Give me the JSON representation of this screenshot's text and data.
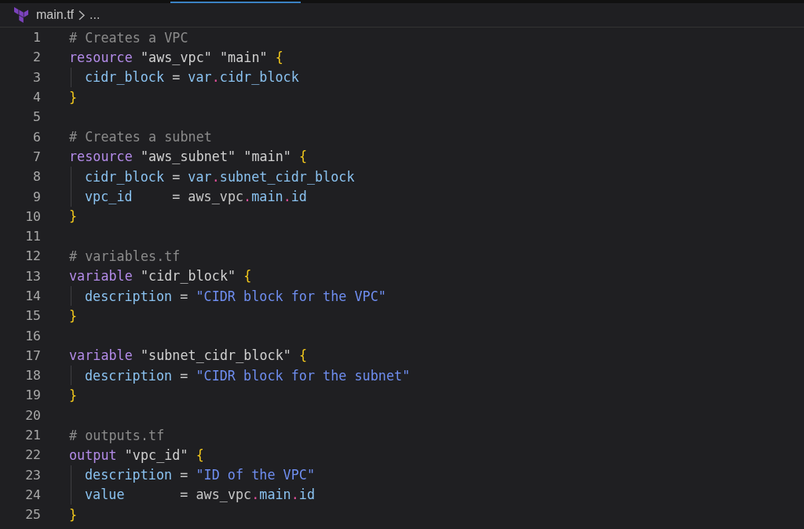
{
  "breadcrumb": {
    "file": "main.tf",
    "more": "..."
  },
  "lines": [
    {
      "number": "1",
      "tokens": [
        {
          "kind": "comment",
          "text": "# Creates a VPC"
        }
      ]
    },
    {
      "number": "2",
      "tokens": [
        {
          "kind": "keyword",
          "text": "resource"
        },
        {
          "kind": "label",
          "text": " \"aws_vpc\""
        },
        {
          "kind": "label",
          "text": " \"main\""
        },
        {
          "kind": "brace",
          "text": " {"
        }
      ],
      "children": [
        {
          "number": "3",
          "tokens": [
            {
              "kind": "attr",
              "text": "cidr_block"
            },
            {
              "kind": "op",
              "text": " = "
            },
            {
              "kind": "attr",
              "text": "var"
            },
            {
              "kind": "dot",
              "text": "."
            },
            {
              "kind": "attr",
              "text": "cidr_block"
            }
          ]
        }
      ]
    },
    {
      "number": "4",
      "tokens": [
        {
          "kind": "brace",
          "text": "}"
        }
      ]
    },
    {
      "number": "5"
    },
    {
      "number": "6",
      "tokens": [
        {
          "kind": "comment",
          "text": "# Creates a subnet"
        }
      ]
    },
    {
      "number": "7",
      "tokens": [
        {
          "kind": "keyword",
          "text": "resource"
        },
        {
          "kind": "label",
          "text": " \"aws_subnet\""
        },
        {
          "kind": "label",
          "text": " \"main\""
        },
        {
          "kind": "brace",
          "text": " {"
        }
      ],
      "children": [
        {
          "number": "8",
          "tokens": [
            {
              "kind": "attr",
              "text": "cidr_block"
            },
            {
              "kind": "op",
              "text": " = "
            },
            {
              "kind": "attr",
              "text": "var"
            },
            {
              "kind": "dot",
              "text": "."
            },
            {
              "kind": "attr",
              "text": "subnet_cidr_block"
            }
          ]
        },
        {
          "number": "9",
          "tokens": [
            {
              "kind": "attr",
              "text": "vpc_id"
            },
            {
              "kind": "op",
              "text": "     = "
            },
            {
              "kind": "plain",
              "text": "aws_vpc"
            },
            {
              "kind": "dot",
              "text": "."
            },
            {
              "kind": "attr",
              "text": "main"
            },
            {
              "kind": "dot",
              "text": "."
            },
            {
              "kind": "attr",
              "text": "id"
            }
          ]
        }
      ]
    },
    {
      "number": "10",
      "tokens": [
        {
          "kind": "brace",
          "text": "}"
        }
      ]
    },
    {
      "number": "11"
    },
    {
      "number": "12",
      "tokens": [
        {
          "kind": "comment",
          "text": "# variables.tf"
        }
      ]
    },
    {
      "number": "13",
      "tokens": [
        {
          "kind": "keyword",
          "text": "variable"
        },
        {
          "kind": "label",
          "text": " \"cidr_block\""
        },
        {
          "kind": "brace",
          "text": " {"
        }
      ],
      "children": [
        {
          "number": "14",
          "tokens": [
            {
              "kind": "attr",
              "text": "description"
            },
            {
              "kind": "op",
              "text": " = "
            },
            {
              "kind": "string",
              "text": "\"CIDR block for the VPC\""
            }
          ]
        }
      ]
    },
    {
      "number": "15",
      "tokens": [
        {
          "kind": "brace",
          "text": "}"
        }
      ]
    },
    {
      "number": "16"
    },
    {
      "number": "17",
      "tokens": [
        {
          "kind": "keyword",
          "text": "variable"
        },
        {
          "kind": "label",
          "text": " \"subnet_cidr_block\""
        },
        {
          "kind": "brace",
          "text": " {"
        }
      ],
      "children": [
        {
          "number": "18",
          "tokens": [
            {
              "kind": "attr",
              "text": "description"
            },
            {
              "kind": "op",
              "text": " = "
            },
            {
              "kind": "string",
              "text": "\"CIDR block for the subnet\""
            }
          ]
        }
      ]
    },
    {
      "number": "19",
      "tokens": [
        {
          "kind": "brace",
          "text": "}"
        }
      ]
    },
    {
      "number": "20"
    },
    {
      "number": "21",
      "tokens": [
        {
          "kind": "comment",
          "text": "# outputs.tf"
        }
      ]
    },
    {
      "number": "22",
      "tokens": [
        {
          "kind": "keyword",
          "text": "output"
        },
        {
          "kind": "label",
          "text": " \"vpc_id\""
        },
        {
          "kind": "brace",
          "text": " {"
        }
      ],
      "children": [
        {
          "number": "23",
          "tokens": [
            {
              "kind": "attr",
              "text": "description"
            },
            {
              "kind": "op",
              "text": " = "
            },
            {
              "kind": "string",
              "text": "\"ID of the VPC\""
            }
          ]
        },
        {
          "number": "24",
          "tokens": [
            {
              "kind": "attr",
              "text": "value"
            },
            {
              "kind": "op",
              "text": "       = "
            },
            {
              "kind": "plain",
              "text": "aws_vpc"
            },
            {
              "kind": "dot",
              "text": "."
            },
            {
              "kind": "attr",
              "text": "main"
            },
            {
              "kind": "dot",
              "text": "."
            },
            {
              "kind": "attr",
              "text": "id"
            }
          ]
        }
      ]
    },
    {
      "number": "25",
      "tokens": [
        {
          "kind": "brace",
          "text": "}"
        }
      ]
    }
  ]
}
